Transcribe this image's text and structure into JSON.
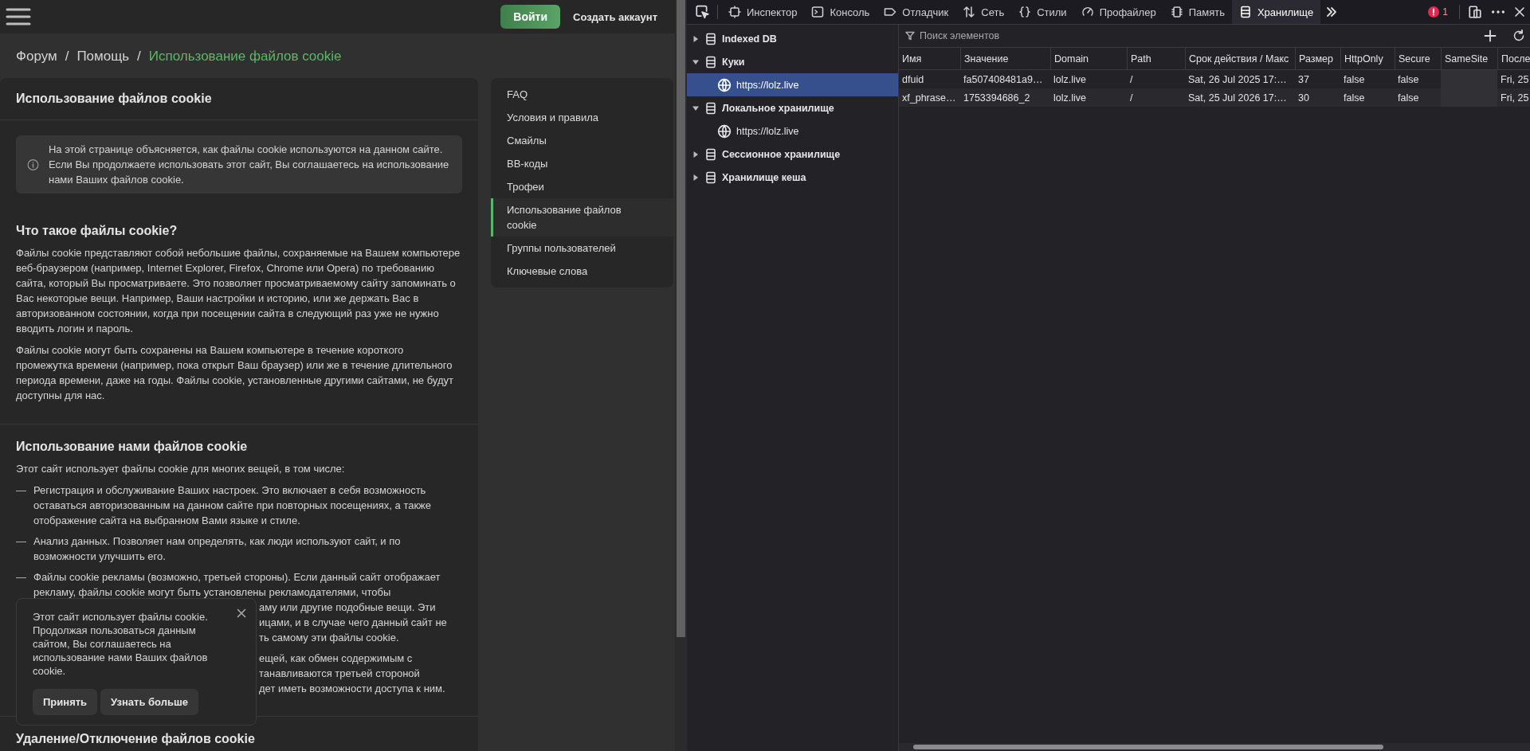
{
  "forum": {
    "topbar": {
      "login": "Войти",
      "register": "Создать аккаунт"
    },
    "breadcrumbs": [
      {
        "label": "Форум",
        "current": false,
        "separator": "/"
      },
      {
        "label": "Помощь",
        "current": false,
        "separator": "/"
      },
      {
        "label": "Использование файлов cookie",
        "current": true
      }
    ],
    "article": {
      "title": "Использование файлов cookie",
      "notice": [
        "На этой странице объясняется, как файлы cookie используются на данном сайте.",
        "Если Вы продолжаете использовать этот сайт, Вы соглашаетесь на использование нами Ваших файлов cookie."
      ],
      "sections": [
        {
          "heading": "Что такое файлы cookie?",
          "paragraphs": [
            "Файлы cookie представляют собой небольшие файлы, сохраняемые на Вашем компьютере веб-браузером (например, Internet Explorer, Firefox, Chrome или Opera) по требованию сайта, который Вы просматриваете. Это позволяет просматриваемому сайту запоминать о Вас некоторые вещи. Например, Ваши настройки и историю, или же держать Вас в авторизованном состоянии, когда при посещении сайта в следующий раз уже не нужно вводить логин и пароль.",
            "Файлы cookie могут быть сохранены на Вашем компьютере в течение короткого промежутка времени (например, пока открыт Ваш браузер) или же в течение длительного периода времени, даже на годы. Файлы cookie, установленные другими сайтами, не будут доступны для нас."
          ]
        },
        {
          "heading": "Использование нами файлов cookie",
          "paragraphs": [
            "Этот сайт использует файлы cookie для многих вещей, в том числе:"
          ],
          "list": [
            {
              "kind": "full",
              "bullet": "—",
              "text": "Регистрация и обслуживание Ваших настроек. Это включает в себя возможность оставаться авторизованным на данном сайте при повторных посещениях, а также отображение сайта на выбранном Вами языке и стиле."
            },
            {
              "kind": "full",
              "bullet": "—",
              "text": "Анализ данных. Позволяет нам определять, как люди используют сайт, и по возможности улучшить его."
            },
            {
              "kind": "partly_covered",
              "bullet": "—",
              "text": "Файлы cookie рекламы (возможно, третьей стороны). Если данный сайт отображает рекламу, файлы cookie могут быть установлены рекламодателями, чтобы",
              "fragments": [
                "аму или другие подобные вещи. Эти",
                "ицами, и в случае чего данный сайт не",
                "ть самому эти файлы cookie."
              ]
            },
            {
              "kind": "covered",
              "fragments": [
                "ещей, как обмен содержимым с",
                "танавливаются третьей стороной",
                "дет иметь возможности доступа к ним."
              ]
            }
          ]
        },
        {
          "heading": "Удаление/Отключение файлов cookie"
        }
      ]
    },
    "nav": [
      {
        "label": "FAQ",
        "selected": false
      },
      {
        "label": "Условия и правила",
        "selected": false
      },
      {
        "label": "Смайлы",
        "selected": false
      },
      {
        "label": "BB-коды",
        "selected": false
      },
      {
        "label": "Трофеи",
        "selected": false
      },
      {
        "label": "Использование файлов cookie",
        "selected": true
      },
      {
        "label": "Группы пользователей",
        "selected": false
      },
      {
        "label": "Ключевые слова",
        "selected": false
      }
    ],
    "cookie_notice": {
      "text": "Этот сайт использует файлы cookie. Продолжая пользоваться данным сайтом, Вы соглашаетесь на использование нами Ваших файлов cookie.",
      "accept": "Принять",
      "more": "Узнать больше"
    }
  },
  "devtools": {
    "tools": [
      {
        "kind": "inspector",
        "label": "Инспектор",
        "selected": false
      },
      {
        "kind": "console",
        "label": "Консоль",
        "selected": false
      },
      {
        "kind": "debugger",
        "label": "Отладчик",
        "selected": false
      },
      {
        "kind": "network",
        "label": "Сеть",
        "selected": false
      },
      {
        "kind": "styles",
        "label": "Стили",
        "selected": false
      },
      {
        "kind": "profiler",
        "label": "Профайлер",
        "selected": false
      },
      {
        "kind": "memory",
        "label": "Память",
        "selected": false
      },
      {
        "kind": "storage",
        "label": "Хранилище",
        "selected": true
      }
    ],
    "error_count": "1",
    "tree": [
      {
        "label": "Indexed DB",
        "expanded": false,
        "selected": false
      },
      {
        "label": "Куки",
        "expanded": true,
        "selected": false,
        "children": [
          {
            "label": "https://lolz.live",
            "selected": true
          }
        ]
      },
      {
        "label": "Локальное хранилище",
        "expanded": true,
        "selected": false,
        "children": [
          {
            "label": "https://lolz.live",
            "selected": false
          }
        ]
      },
      {
        "label": "Сессионное хранилище",
        "expanded": false,
        "selected": false
      },
      {
        "label": "Хранилище кеша",
        "expanded": false,
        "selected": false
      }
    ],
    "search": {
      "placeholder": "Поиск элементов"
    },
    "table": {
      "columns": [
        "Имя",
        "Значение",
        "Domain",
        "Path",
        "Срок действия / Макс",
        "Размер",
        "HttpOnly",
        "Secure",
        "SameSite",
        "После"
      ],
      "rows": [
        [
          "dfuid",
          "fa507408481a9…",
          "lolz.live",
          "/",
          "Sat, 26 Jul 2025 17:…",
          "37",
          "false",
          "false",
          null,
          "Fri, 25"
        ],
        [
          "xf_phrase…",
          "1753394686_2",
          "lolz.live",
          "/",
          "Sat, 25 Jul 2026 17:…",
          "30",
          "false",
          "false",
          null,
          "Fri, 25"
        ]
      ]
    }
  }
}
